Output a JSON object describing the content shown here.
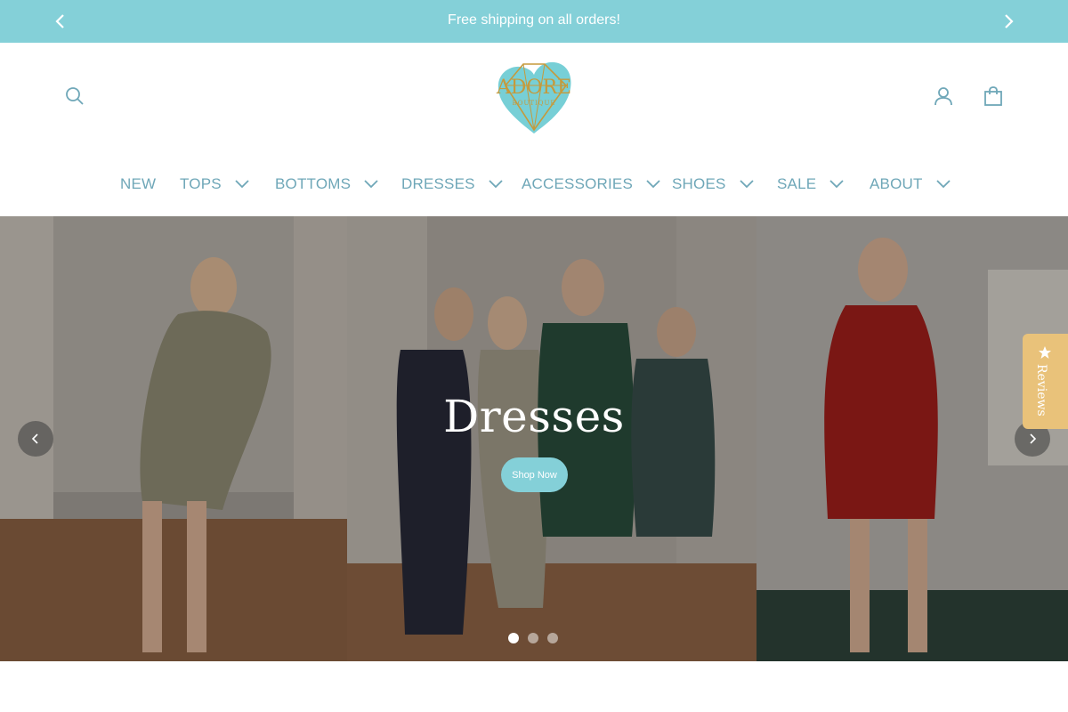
{
  "announcement": {
    "text": "Free shipping on all orders!",
    "prev_icon": "chevron-left-icon",
    "next_icon": "chevron-right-icon"
  },
  "header": {
    "logo": {
      "text": "ADORE",
      "subtext": "BOUTIQUE"
    },
    "icons": {
      "search": "search-icon",
      "account": "user-icon",
      "cart": "shopping-bag-icon"
    }
  },
  "nav": {
    "items": [
      {
        "label": "NEW",
        "has_dropdown": false
      },
      {
        "label": "TOPS",
        "has_dropdown": true
      },
      {
        "label": "BOTTOMS",
        "has_dropdown": true
      },
      {
        "label": "DRESSES",
        "has_dropdown": true
      },
      {
        "label": "ACCESSORIES",
        "has_dropdown": true
      },
      {
        "label": "SHOES",
        "has_dropdown": true
      },
      {
        "label": "SALE",
        "has_dropdown": true
      },
      {
        "label": "ABOUT",
        "has_dropdown": true
      }
    ]
  },
  "hero": {
    "title": "Dresses",
    "button_label": "Shop Now",
    "slide_count": 3,
    "active_slide": 1
  },
  "reviews_tab": {
    "label": "Reviews",
    "icon": "star-icon"
  },
  "colors": {
    "accent": "#84d0d8",
    "nav_text": "#6fa7b8",
    "reviews_tab": "#e9c27a"
  }
}
